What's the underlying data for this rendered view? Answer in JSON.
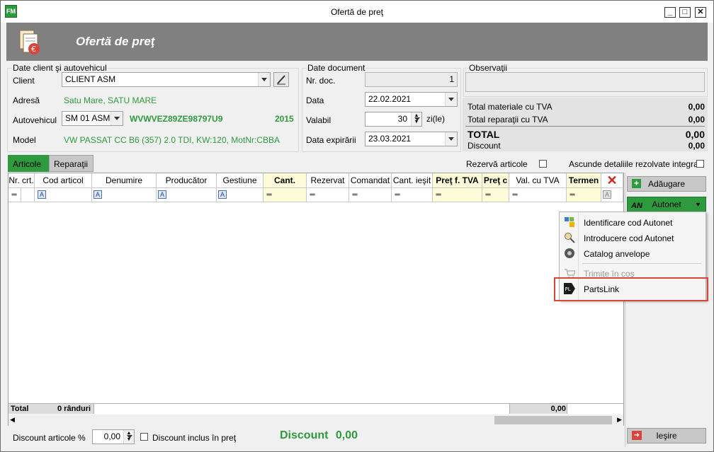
{
  "window": {
    "title": "Ofertă de preţ",
    "app_logo": "FM"
  },
  "header": {
    "title": "Ofertă de preţ"
  },
  "client_section": {
    "legend": "Date client şi autovehicul",
    "client_label": "Client",
    "client_value": "CLIENT ASM",
    "address_label": "Adresă",
    "address_value": "Satu Mare, SATU MARE",
    "vehicle_label": "Autovehicul",
    "vehicle_value": "SM 01 ASM",
    "vin": "WVWVEZ89ZE98797U9",
    "year": "2015",
    "model_label": "Model",
    "model_value": "VW PASSAT CC B6 (357) 2.0 TDI, KW:120, MotNr:CBBA"
  },
  "document_section": {
    "legend": "Date document",
    "nr_label": "Nr. doc.",
    "nr_value": "1",
    "date_label": "Data",
    "date_value": "22.02.2021",
    "valid_label": "Valabil",
    "valid_value": "30",
    "valid_unit": "zi(le)",
    "expiry_label": "Data expirării",
    "expiry_value": "23.03.2021"
  },
  "observations": {
    "legend": "Observaţii"
  },
  "totals": {
    "materials_label": "Total materiale cu TVA",
    "materials_value": "0,00",
    "repairs_label": "Total reparaţii cu TVA",
    "repairs_value": "0,00",
    "total_label": "TOTAL",
    "total_value": "0,00",
    "discount_label": "Discount",
    "discount_value": "0,00"
  },
  "tabs": [
    "Articole",
    "Reparaţii"
  ],
  "options": {
    "reserve_label": "Rezervă articole",
    "hide_label": "Ascunde detaliile rezolvate integral"
  },
  "grid": {
    "columns": [
      "Nr. crt.",
      "Cod articol",
      "Denumire",
      "Producător",
      "Gestiune",
      "Cant.",
      "Rezervat",
      "Comandat",
      "Cant. ieşit",
      "Preţ f. TVA",
      "Preţ c",
      "Val. cu TVA",
      "Termen"
    ],
    "total_label": "Total",
    "rows_label": "0 rânduri",
    "total_value": "0,00"
  },
  "sidebar": {
    "add_label": "Adăugare",
    "autonet_label": "Autonet",
    "exit_label": "Ieşire"
  },
  "autonet_menu": {
    "items": [
      "Identificare cod Autonet",
      "Introducere cod Autonet",
      "Catalog anvelope",
      "Trimite în coş",
      "PartsLink"
    ]
  },
  "footer": {
    "discount_pct_label": "Discount articole %",
    "discount_pct_value": "0,00",
    "discount_incl_label": "Discount inclus în preţ",
    "discount_big_label": "Discount",
    "discount_big_value": "0,00"
  },
  "colors": {
    "green": "#2e9a3e",
    "header_gray": "#808080",
    "highlight_red": "#d9453a"
  }
}
